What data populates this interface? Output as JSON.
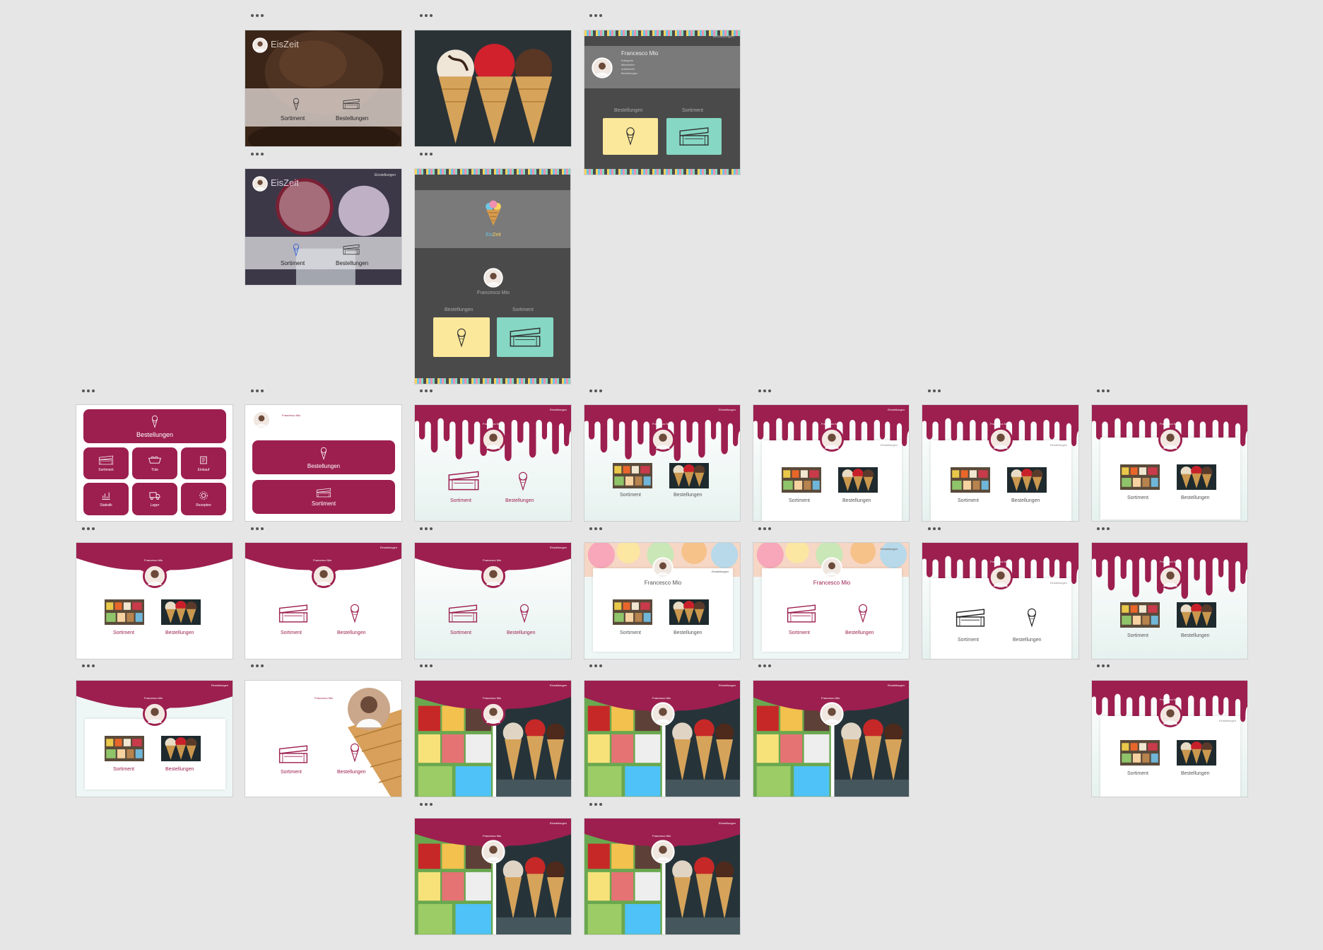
{
  "app": {
    "brand": "EisZeit",
    "brand_eis": "Eis",
    "brand_zeit": "Zeit",
    "user": "Francesco Mio",
    "settings": "Einstellungen",
    "sortiment": "Sortiment",
    "bestellungen": "Bestellungen",
    "tuete": "Tüte",
    "einkauf": "Einkauf",
    "statistik": "Statistik",
    "lager": "Lager",
    "rezepte": "Rezepten",
    "profile_lines": [
      "Kategorie",
      "Mitarbeiter",
      "Arbeitszeit",
      "Bestellungen",
      "Aktiv"
    ]
  },
  "colors": {
    "brand": "#9c1f4f",
    "dark": "#4a4a4a",
    "band": "#7a7a7a",
    "yellow": "#fbe89a",
    "teal": "#86d8c4",
    "mint": "#eef7f5",
    "canvas": "#e6e6e6"
  },
  "icons": [
    "ice-cream-cone-icon",
    "display-freezer-icon",
    "cup-icon",
    "cart-icon",
    "chart-icon",
    "truck-icon",
    "gear-icon",
    "more-icon"
  ]
}
